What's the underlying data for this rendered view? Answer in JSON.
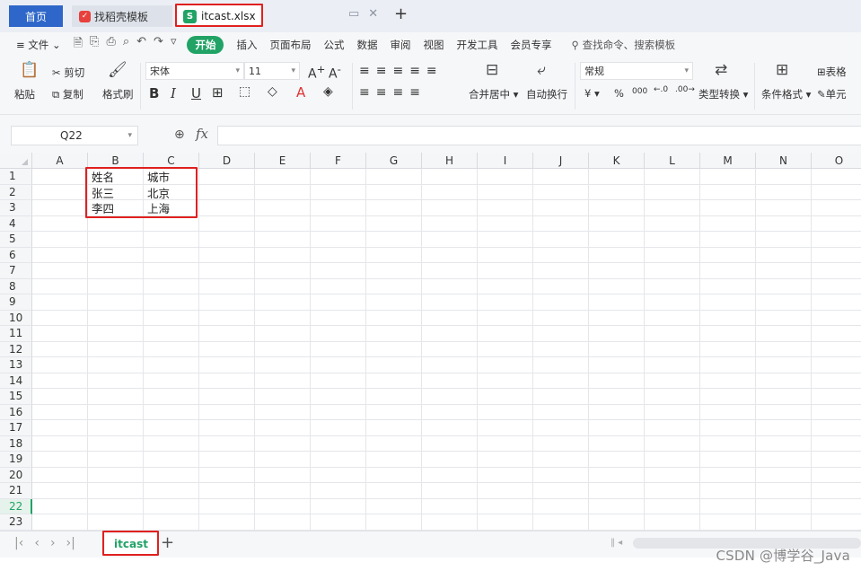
{
  "tabs": {
    "home": "首页",
    "template": "找稻壳模板",
    "file": "itcast.xlsx",
    "file_icon": "S"
  },
  "menu": {
    "file": "文件",
    "start": "开始",
    "items": [
      "插入",
      "页面布局",
      "公式",
      "数据",
      "审阅",
      "视图",
      "开发工具",
      "会员专享"
    ],
    "search": "查找命令、搜索模板"
  },
  "ribbon": {
    "paste": "粘贴",
    "cut": "剪切",
    "copy": "复制",
    "format_painter": "格式刷",
    "font_name": "宋体",
    "font_size": "11",
    "merge": "合并居中",
    "wrap": "自动换行",
    "number_format": "常规",
    "currency": "¥",
    "percent": "%",
    "thousands": "000",
    "convert": "类型转换",
    "cond_format": "条件格式",
    "table_style": "表格",
    "cell_style": "单元"
  },
  "formula": {
    "name_box": "Q22",
    "fx": "fx",
    "value": ""
  },
  "grid": {
    "columns": [
      "A",
      "B",
      "C",
      "D",
      "E",
      "F",
      "G",
      "H",
      "I",
      "J",
      "K",
      "L",
      "M",
      "N",
      "O"
    ],
    "rows": [
      "1",
      "2",
      "3",
      "4",
      "5",
      "6",
      "7",
      "8",
      "9",
      "10",
      "11",
      "12",
      "13",
      "14",
      "15",
      "16",
      "17",
      "18",
      "19",
      "20",
      "21",
      "22",
      "23"
    ],
    "selected_row": "22",
    "data": [
      [
        "姓名",
        "城市"
      ],
      [
        "张三",
        "北京"
      ],
      [
        "李四",
        "上海"
      ]
    ]
  },
  "sheets": {
    "active": "itcast"
  },
  "watermark": "CSDN @博学谷_Java",
  "colors": {
    "accent_green": "#21a366",
    "highlight_red": "#e0201f",
    "home_tab_blue": "#2e66c9"
  }
}
